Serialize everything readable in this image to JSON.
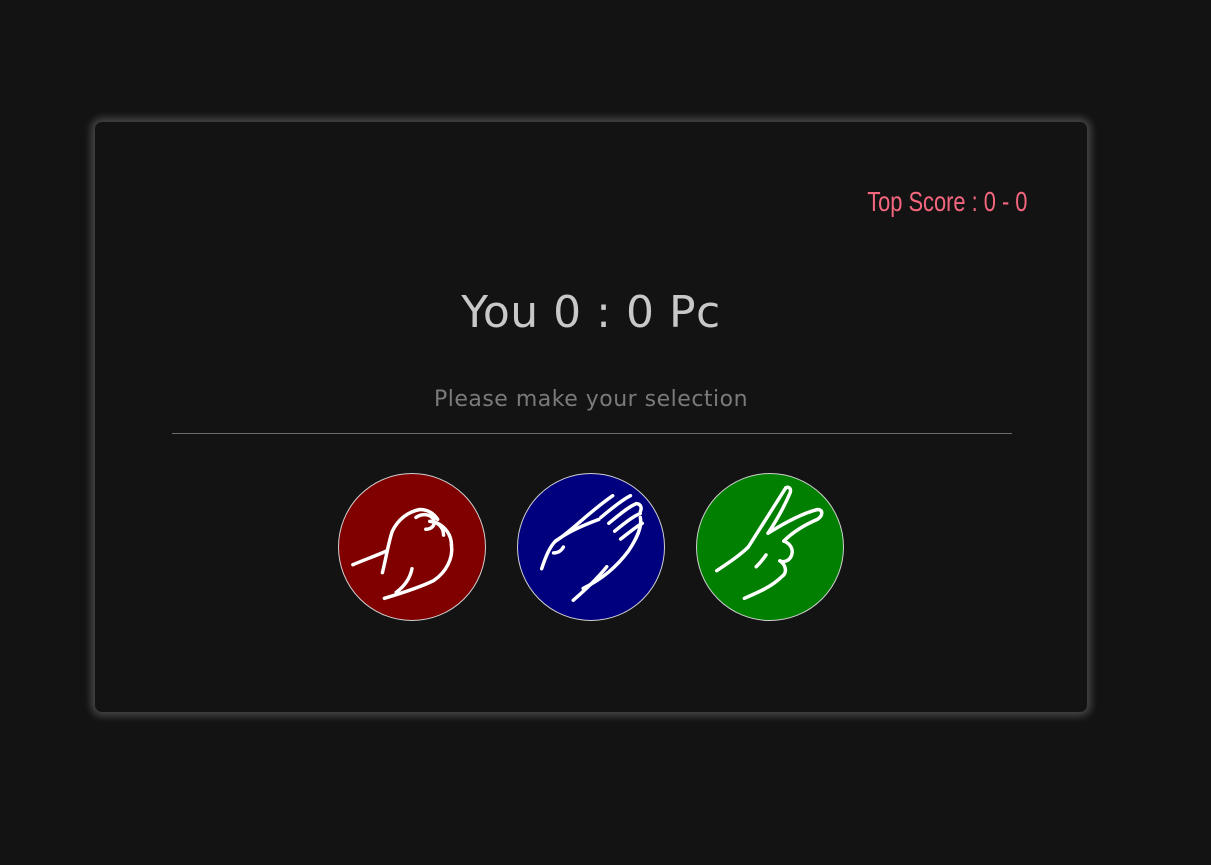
{
  "top_score": {
    "label": "Top Score : 0 - 0"
  },
  "scoreboard": {
    "you_label": "You",
    "you_score": "0",
    "separator": ":",
    "pc_score": "0",
    "pc_label": "Pc"
  },
  "message": "Please make your selection",
  "choices": [
    {
      "name": "rock",
      "icon": "rock-hand-icon",
      "color": "#800000"
    },
    {
      "name": "paper",
      "icon": "paper-hand-icon",
      "color": "#00007f"
    },
    {
      "name": "scissors",
      "icon": "scissors-hand-icon",
      "color": "#007f00"
    }
  ],
  "colors": {
    "background": "#131313",
    "accent": "#f3667e",
    "score_text": "#c8c8c8",
    "message_text": "#7a7a7a"
  }
}
